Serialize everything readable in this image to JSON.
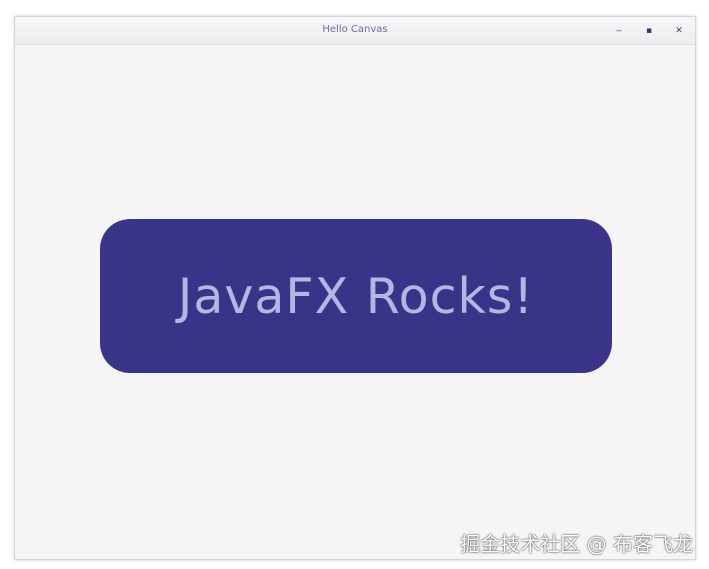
{
  "window": {
    "title": "Hello Canvas"
  },
  "controls": {
    "minimize": "‒",
    "maximize": "▪",
    "close": "✕"
  },
  "canvas": {
    "text": "JavaFX Rocks!",
    "fill_color": "#3a3488",
    "text_color": "#b3b7e4"
  },
  "watermark": {
    "text": "掘金技术社区 @ 布客飞龙"
  }
}
